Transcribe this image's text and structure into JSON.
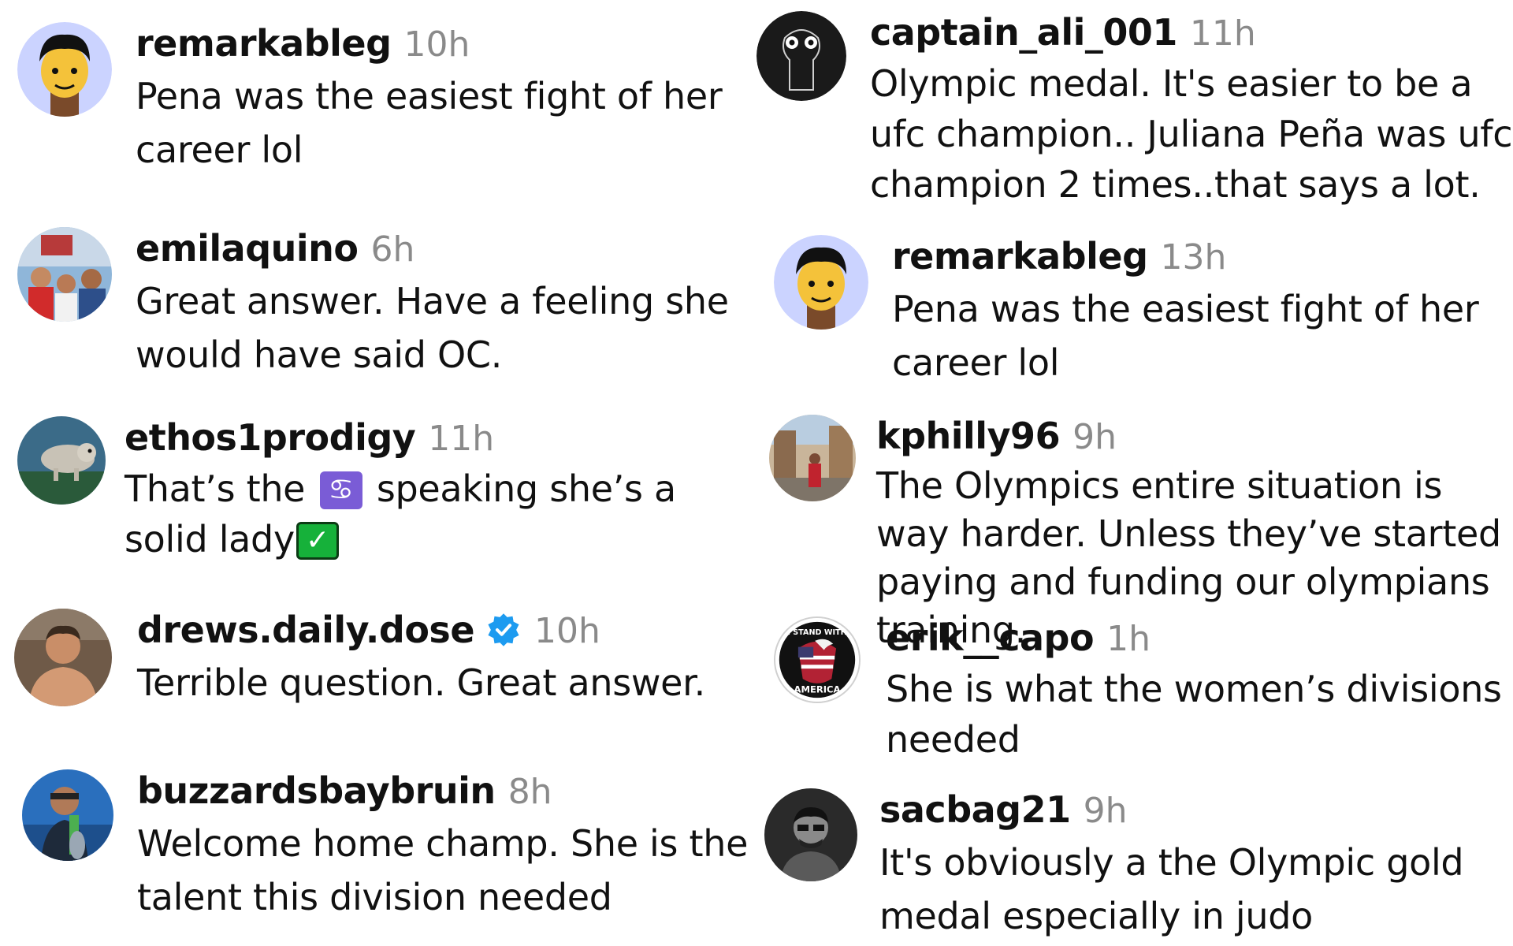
{
  "comments": [
    {
      "username": "remarkableg",
      "time": "10h",
      "text": "Pena was the easiest fight of her career lol",
      "avatar": "cartoon-boy-avatar"
    },
    {
      "username": "emilaquino",
      "time": "6h",
      "text": "Great answer. Have a feeling she would have said OC.",
      "avatar": "family-photo-avatar"
    },
    {
      "username": "ethos1prodigy",
      "time": "11h",
      "text_before": "That’s the",
      "emoji": "♋",
      "text_middle": "speaking she’s a solid lady",
      "check": "✓",
      "avatar": "animal-photo-avatar"
    },
    {
      "username": "drews.daily.dose",
      "time": "10h",
      "text": "Terrible question. Great answer.",
      "verified": true,
      "avatar": "man-photo-avatar"
    },
    {
      "username": "buzzardsbaybruin",
      "time": "8h",
      "text": "Welcome home champ. She is the talent this division needed",
      "avatar": "fisherman-photo-avatar"
    },
    {
      "username": "captain_ali_001",
      "time": "11h",
      "text": "Olympic medal. It's easier to be a ufc champion.. Juliana Peña was ufc champion 2 times..that says a lot.",
      "avatar": "keyhole-face-avatar"
    },
    {
      "username": "remarkableg",
      "time": "13h",
      "text": "Pena was the easiest fight of her career lol",
      "avatar": "cartoon-boy-avatar"
    },
    {
      "username": "kphilly96",
      "time": "9h",
      "text": "The Olympics entire situation is way harder. Unless they’ve started paying and funding our olympians training.",
      "avatar": "street-photo-avatar"
    },
    {
      "username": "erik__capo",
      "time": "1h",
      "text": "She is what the women’s divisions needed",
      "avatar_text_top": "I STAND WITH",
      "avatar_text_bottom": "AMERICA",
      "avatar": "eagle-flag-avatar"
    },
    {
      "username": "sacbag21",
      "time": "9h",
      "text": "It's obviously a the Olympic gold medal especially in judo",
      "avatar": "bw-man-avatar"
    }
  ],
  "colors": {
    "time": "#8a8a8a",
    "verified": "#1d9bf0",
    "text": "#111111"
  }
}
